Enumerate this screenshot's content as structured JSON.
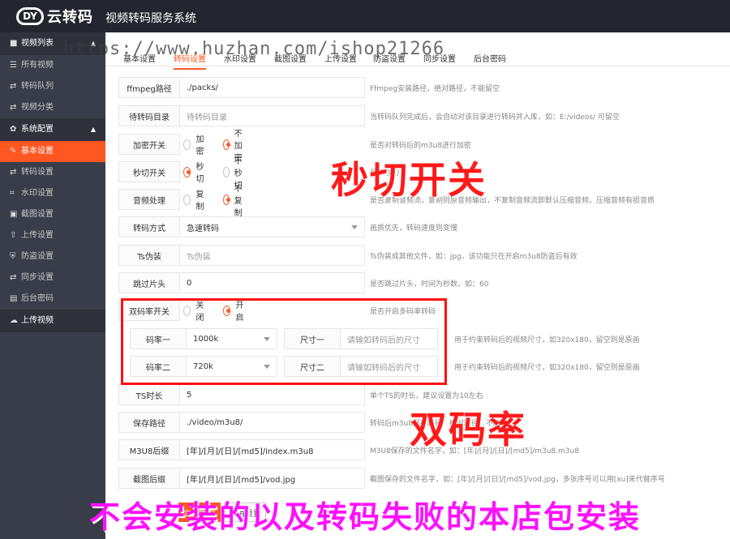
{
  "header": {
    "logo_text": "云转码",
    "logo_mark": "DY",
    "system_title": "视频转码服务系统"
  },
  "sidebar": {
    "groups": [
      {
        "label": "视频列表",
        "icon": "video-icon"
      },
      {
        "label": "系统配置",
        "icon": "gear-icon"
      }
    ],
    "items": [
      {
        "label": "所有视频",
        "icon": "list-icon"
      },
      {
        "label": "转码队列",
        "icon": "swap-icon"
      },
      {
        "label": "视频分类",
        "icon": "swap-icon"
      },
      {
        "label": "基本设置",
        "icon": "edit-icon"
      },
      {
        "label": "转码设置",
        "icon": "swap-icon"
      },
      {
        "label": "水印设置",
        "icon": "crop-icon"
      },
      {
        "label": "截图设置",
        "icon": "image-icon"
      },
      {
        "label": "上传设置",
        "icon": "upload-icon"
      },
      {
        "label": "防盗设置",
        "icon": "shield-icon"
      },
      {
        "label": "同步设置",
        "icon": "swap-icon"
      },
      {
        "label": "后台密码",
        "icon": "lock-icon"
      },
      {
        "label": "上传视频",
        "icon": "cloud-upload-icon"
      }
    ]
  },
  "tabs": [
    "基本设置",
    "转码设置",
    "水印设置",
    "截图设置",
    "上传设置",
    "防盗设置",
    "同步设置",
    "后台密码"
  ],
  "form": {
    "ffmpeg": {
      "label": "ffmpeg路径",
      "value": "./packs/",
      "hint": "Ffmpeg安装路径，绝对路径，不能留空"
    },
    "queue_dir": {
      "label": "待转码目录",
      "placeholder": "待转码目录",
      "hint": "当转码队列完成后，会自动对该目录进行转码并入库，如：E:/videos/ 可留空"
    },
    "encrypt": {
      "label": "加密开关",
      "opt1": "加密",
      "opt2": "不加密",
      "hint": "是否对转码后的m3u8进行加密"
    },
    "fastcut": {
      "label": "秒切开关",
      "opt1": "秒切",
      "opt2": "不秒切",
      "hint": "是否秒切"
    },
    "audio": {
      "label": "音频处理",
      "opt1": "复制",
      "opt2": "不复制",
      "hint": "是否复制音频流，复制则原音频输出，不复制音频流即默认压缩音频，压缩音频有损音质"
    },
    "mode": {
      "label": "转码方式",
      "value": "急速转码",
      "hint": "画质优先，转码速度则变慢"
    },
    "ts_fake": {
      "label": "Ts伪装",
      "placeholder": "Ts伪装",
      "hint": "Ts伪装成其他文件，如：jpg，该功能只在开启m3u8防盗后有效"
    },
    "skip_head": {
      "label": "跳过片头",
      "value": "0",
      "hint": "是否跳过片头，时间为秒数，如：60"
    },
    "dual_rate": {
      "label": "双码率开关",
      "opt1": "关闭",
      "opt2": "开启",
      "hint": "是否开启多码率转码"
    },
    "rate1": {
      "label": "码率一",
      "value": "1000k",
      "size_label": "尺寸一",
      "size_placeholder": "请输如转码后的尺寸",
      "hint": "用于约束转码后的视频尺寸，如320x180，留空则是原画"
    },
    "rate2": {
      "label": "码率二",
      "value": "720k",
      "size_label": "尺寸二",
      "size_placeholder": "请输如转码后的尺寸",
      "hint": "用于约束转码后的视频尺寸，如320x180，留空则是原画"
    },
    "ts_len": {
      "label": "TS时长",
      "value": "5",
      "hint": "单个TS的时长，建议设置为10左右"
    },
    "save_path": {
      "label": "保存路径",
      "value": "./video/m3u8/",
      "hint": "转码后m3u8保存路径，绝对路径，不能留空"
    },
    "m3u8_suffix": {
      "label": "M3U8后缀",
      "value": "[年]/[月]/[日]/[md5]/index.m3u8",
      "hint": "M3U8保存的文件名字，如：[年]/[月]/[日]/[md5]/m3u8.m3u8"
    },
    "shot_suffix": {
      "label": "截图后缀",
      "value": "[年]/[月]/[日]/[md5]/vod.jpg",
      "hint": "截图保存的文件名字，如：[年]/[月]/[日]/[md5]/vod.jpg，多张序号可以用[xu]来代替序号"
    },
    "submit_label": "立即提交",
    "reset_label": "取消重置"
  },
  "overlays": {
    "watermark": "https://www.huzhan.com/ishop21266",
    "annotation_fastcut": "秒切开关",
    "annotation_dual": "双码率",
    "banner": "不会安装的以及转码失败的本店包安装"
  },
  "colors": {
    "accent": "#ff5722",
    "sidebar_bg": "#393d49",
    "header_bg": "#23262e",
    "annotation_red": "#ff1a1a",
    "banner_magenta": "#ff10ff"
  }
}
